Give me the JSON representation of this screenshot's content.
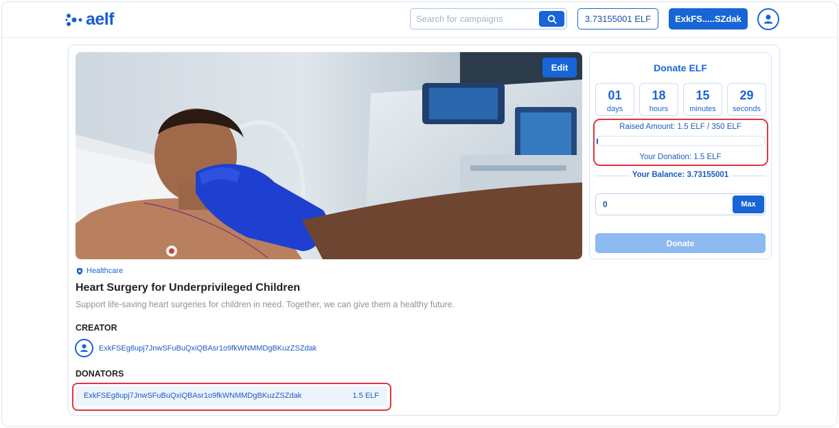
{
  "header": {
    "logo_text": "aelf",
    "search_placeholder": "Search for campaigns",
    "balance": "3.73155001 ELF",
    "wallet": "ExkFS.....SZdak"
  },
  "campaign": {
    "edit_label": "Edit",
    "category": "Healthcare",
    "title": "Heart Surgery for Underprivileged Children",
    "description": "Support life-saving heart surgeries for children in need. Together, we can give them a healthy future.",
    "creator_heading": "CREATOR",
    "creator_address": "ExkFSEg8upj7JnwSFuBuQxiQBAsr1o9fkWNMMDgBKuzZSZdak",
    "donators_heading": "DONATORS",
    "donators": [
      {
        "address": "ExkFSEg8upj7JnwSFuBuQxiQBAsr1o9fkWNMMDgBKuzZSZdak",
        "amount": "1.5 ELF"
      }
    ]
  },
  "donate": {
    "title": "Donate ELF",
    "countdown": [
      {
        "value": "01",
        "unit": "days"
      },
      {
        "value": "18",
        "unit": "hours"
      },
      {
        "value": "15",
        "unit": "minutes"
      },
      {
        "value": "29",
        "unit": "seconds"
      }
    ],
    "raised_text": "Raised Amount: 1.5 ELF / 350 ELF",
    "progress_fraction": 0.0043,
    "your_donation": "Your Donation: 1.5 ELF",
    "your_balance": "Your Balance: 3.73155001",
    "amount_value": "0",
    "max_label": "Max",
    "donate_label": "Donate"
  },
  "colors": {
    "primary": "#1765d6",
    "highlight": "#e0343c",
    "disabled_button": "#8ebaf2"
  }
}
